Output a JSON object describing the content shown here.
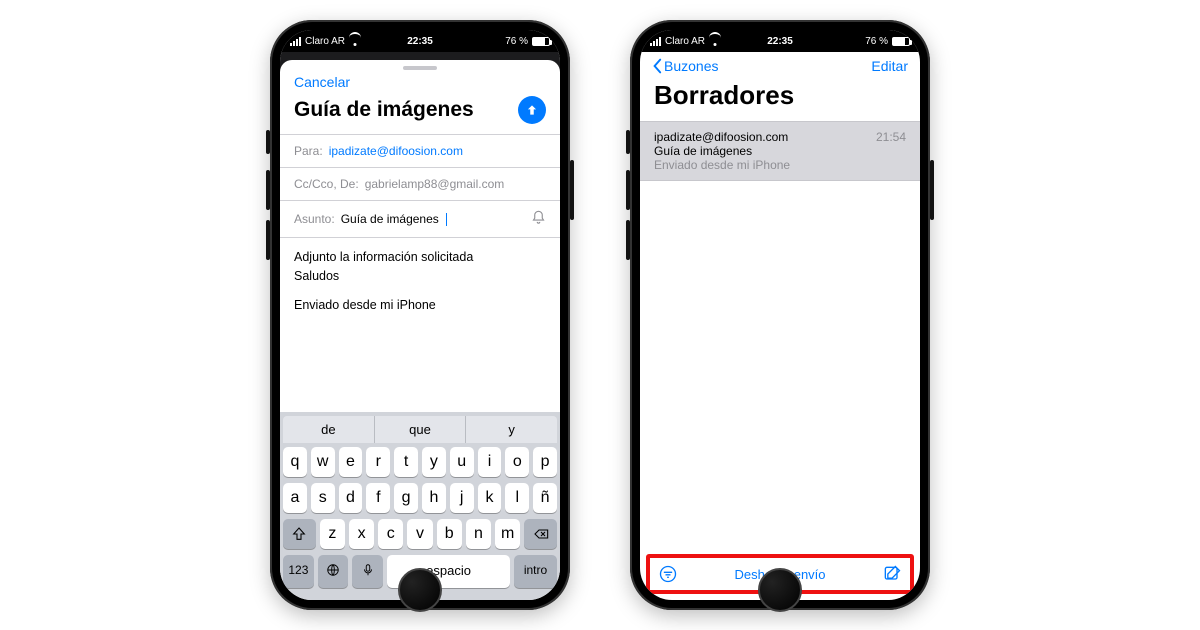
{
  "status": {
    "carrier": "Claro AR",
    "time": "22:35",
    "battery": "76 %"
  },
  "compose": {
    "cancel": "Cancelar",
    "title": "Guía de imágenes",
    "to_label": "Para:",
    "to_value": "ipadizate@difoosion.com",
    "cc_label": "Cc/Cco, De:",
    "cc_value": "gabrielamp88@gmail.com",
    "subject_label": "Asunto:",
    "subject_value": "Guía de imágenes",
    "body_line1": "Adjunto la información solicitada",
    "body_line2": "Saludos",
    "signature": "Enviado desde mi iPhone"
  },
  "keyboard": {
    "suggestions": [
      "de",
      "que",
      "y"
    ],
    "row1": [
      "q",
      "w",
      "e",
      "r",
      "t",
      "y",
      "u",
      "i",
      "o",
      "p"
    ],
    "row2": [
      "a",
      "s",
      "d",
      "f",
      "g",
      "h",
      "j",
      "k",
      "l",
      "ñ"
    ],
    "row3": [
      "z",
      "x",
      "c",
      "v",
      "b",
      "n",
      "m"
    ],
    "numKey": "123",
    "space": "espacio",
    "enter": "intro"
  },
  "drafts": {
    "back": "Buzones",
    "edit": "Editar",
    "title": "Borradores",
    "item": {
      "from": "ipadizate@difoosion.com",
      "subject": "Guía de imágenes",
      "preview": "Enviado desde mi iPhone",
      "time": "21:54"
    },
    "undo": "Deshacer envío"
  }
}
